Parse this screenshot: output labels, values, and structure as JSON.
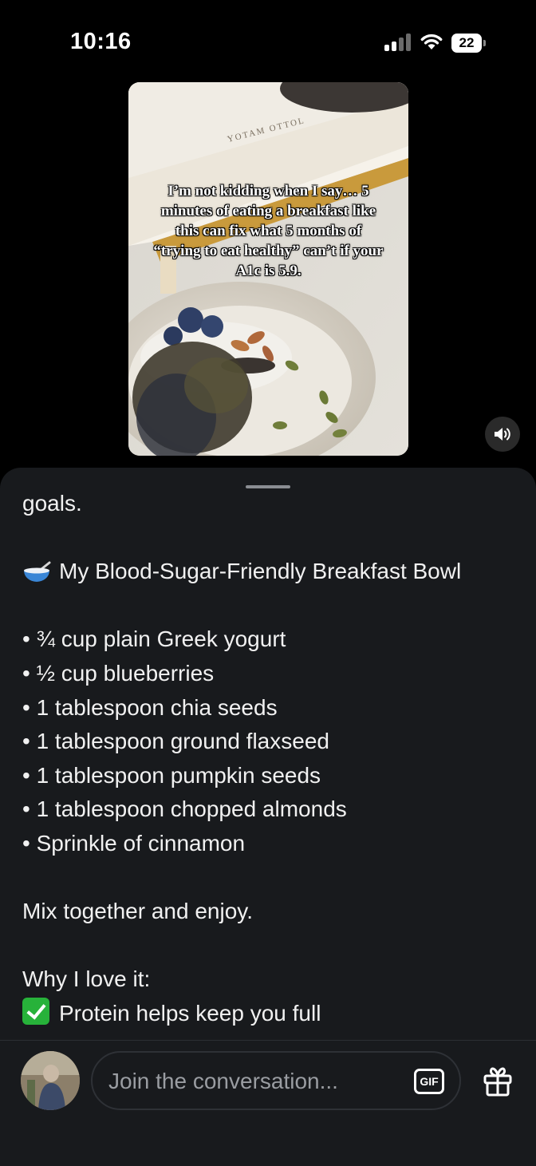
{
  "status_bar": {
    "time": "10:16",
    "battery_level": "22"
  },
  "video": {
    "book_spine_text": "YOTAM OTTOL",
    "caption_lines": [
      "I’m not kidding when I say… 5",
      "minutes of eating a breakfast like",
      "this can fix what 5 months of",
      "“trying to eat healthy” can’t if your",
      "A1c is 5.9."
    ],
    "sound_icon": "speaker-icon"
  },
  "post": {
    "lines": [
      "goals.",
      "",
      "My Blood-Sugar-Friendly Breakfast Bowl",
      "",
      "• ¾ cup plain Greek yogurt",
      "• ½ cup blueberries",
      "• 1 tablespoon chia seeds",
      "• 1 tablespoon ground flaxseed",
      "• 1 tablespoon pumpkin seeds",
      "• 1 tablespoon chopped almonds",
      "• Sprinkle of cinnamon",
      "",
      "Mix together and enjoy.",
      "",
      "Why I love it:",
      "Protein helps keep you full"
    ],
    "bowl_icon": "bowl-emoji-icon",
    "check_icon": "check-mark-emoji-icon"
  },
  "composer": {
    "placeholder": "Join the conversation...",
    "gif_label": "GIF",
    "gift_icon": "gift-icon"
  },
  "colors": {
    "sheet_background": "#181a1d",
    "check_green": "#27b23a"
  }
}
